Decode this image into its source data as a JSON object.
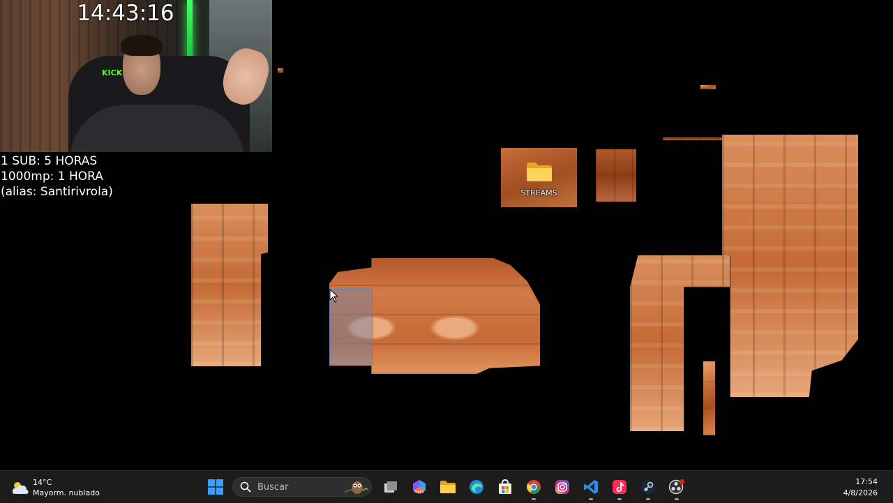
{
  "overlay": {
    "timer": "14:43:16",
    "info_lines": [
      "1 SUB: 5 HORAS",
      "1000mp: 1 HORA",
      "(alias: Santirivrola)"
    ],
    "webcam_logo": "KICK"
  },
  "desktop": {
    "icons": [
      {
        "label": "STREAMS",
        "icon": "folder-icon"
      }
    ]
  },
  "taskbar": {
    "weather": {
      "temp": "14°C",
      "condition": "Mayorm. nublado",
      "icon": "cloudy-icon"
    },
    "search_placeholder": "Buscar",
    "apps": [
      {
        "name": "start",
        "icon": "windows-logo-icon"
      },
      {
        "name": "task-view",
        "icon": "task-view-icon"
      },
      {
        "name": "m365",
        "icon": "m365-icon"
      },
      {
        "name": "file-explorer",
        "icon": "folder-icon"
      },
      {
        "name": "edge",
        "icon": "edge-icon"
      },
      {
        "name": "store",
        "icon": "store-icon"
      },
      {
        "name": "chrome",
        "icon": "chrome-icon"
      },
      {
        "name": "instagram",
        "icon": "instagram-icon"
      },
      {
        "name": "vscode",
        "icon": "vscode-icon"
      },
      {
        "name": "tiktok",
        "icon": "tiktok-icon"
      },
      {
        "name": "steam",
        "icon": "steam-icon"
      },
      {
        "name": "obs",
        "icon": "obs-icon"
      }
    ],
    "clock": {
      "time": "17:54",
      "date": "4/8/2026"
    }
  },
  "colors": {
    "taskbar_bg": "#1c1c1c",
    "kick_green": "#53fc18",
    "selection": "#5b7fbf"
  }
}
